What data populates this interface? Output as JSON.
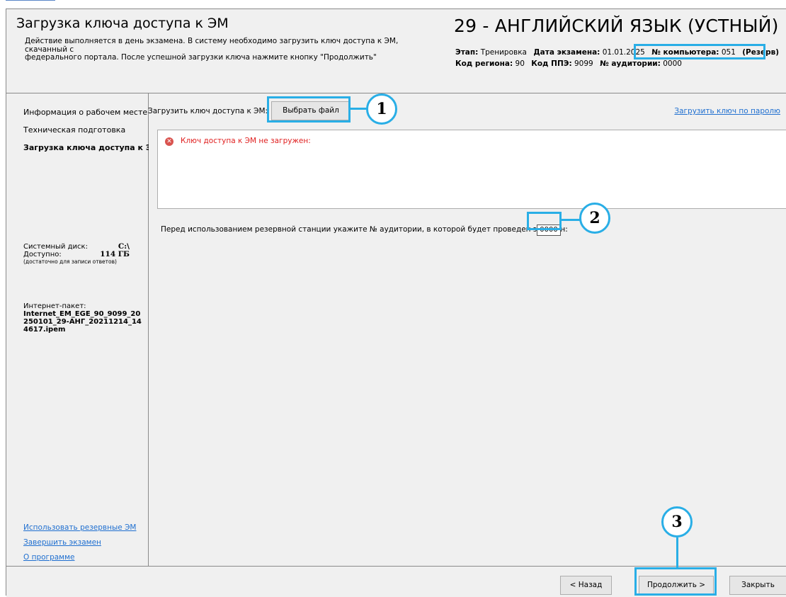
{
  "header": {
    "title": "Загрузка ключа доступа к ЭМ",
    "description": "Действие выполняется в день экзамена. В систему необходимо загрузить ключ доступа к ЭМ, скачанный с\nфедерального портала. После успешной загрузки ключа нажмите кнопку \"Продолжить\"",
    "exam_title": "29 - АНГЛИЙСКИЙ ЯЗЫК (УСТНЫЙ)",
    "stage_label": "Этап:",
    "stage_value": "Тренировка",
    "date_label": "Дата экзамена:",
    "date_value": "01.01.2025",
    "computer_label": "№ компьютера:",
    "computer_value": "051",
    "computer_mode": "(Резерв)",
    "region_label": "Код региона:",
    "region_value": "90",
    "ppe_label": "Код ППЭ:",
    "ppe_value": "9099",
    "room_label": "№ аудитории:",
    "room_value": "0000"
  },
  "sidebar": {
    "items": [
      {
        "label": "Информация о рабочем месте"
      },
      {
        "label": "Техническая подготовка"
      },
      {
        "label": "Загрузка ключа доступа к ЭМ"
      }
    ],
    "disk_label": "Системный диск:",
    "disk_value": "C:\\",
    "free_label": "Доступно:",
    "free_value": "114 ГБ",
    "free_note": "(достаточно для записи ответов)",
    "package_label": "Интернет-пакет:",
    "package_name": "Internet_EM_EGE_90_9099_20250101_29-АНГ_20211214_144617.ipem",
    "links": [
      {
        "label": "Использовать резервные ЭМ"
      },
      {
        "label": "Завершить экзамен"
      },
      {
        "label": "О программе"
      }
    ]
  },
  "main": {
    "key_label": "Загрузить ключ доступа к ЭМ:",
    "choose_file_button": "Выбрать файл",
    "password_link": "Загрузить ключ по паролю",
    "error_icon": "error-circle-icon",
    "error_text": "Ключ доступа к ЭМ не загружен:",
    "auditorium_prompt": "Перед использованием резервной станции укажите № аудитории, в которой будет проведен экзамен:",
    "auditorium_value": "0000"
  },
  "footer": {
    "back_button": "< Назад",
    "continue_button": "Продолжить >",
    "close_button": "Закрыть"
  },
  "callouts": {
    "one": "1",
    "two": "2",
    "three": "3",
    "color": "#29aee6"
  }
}
